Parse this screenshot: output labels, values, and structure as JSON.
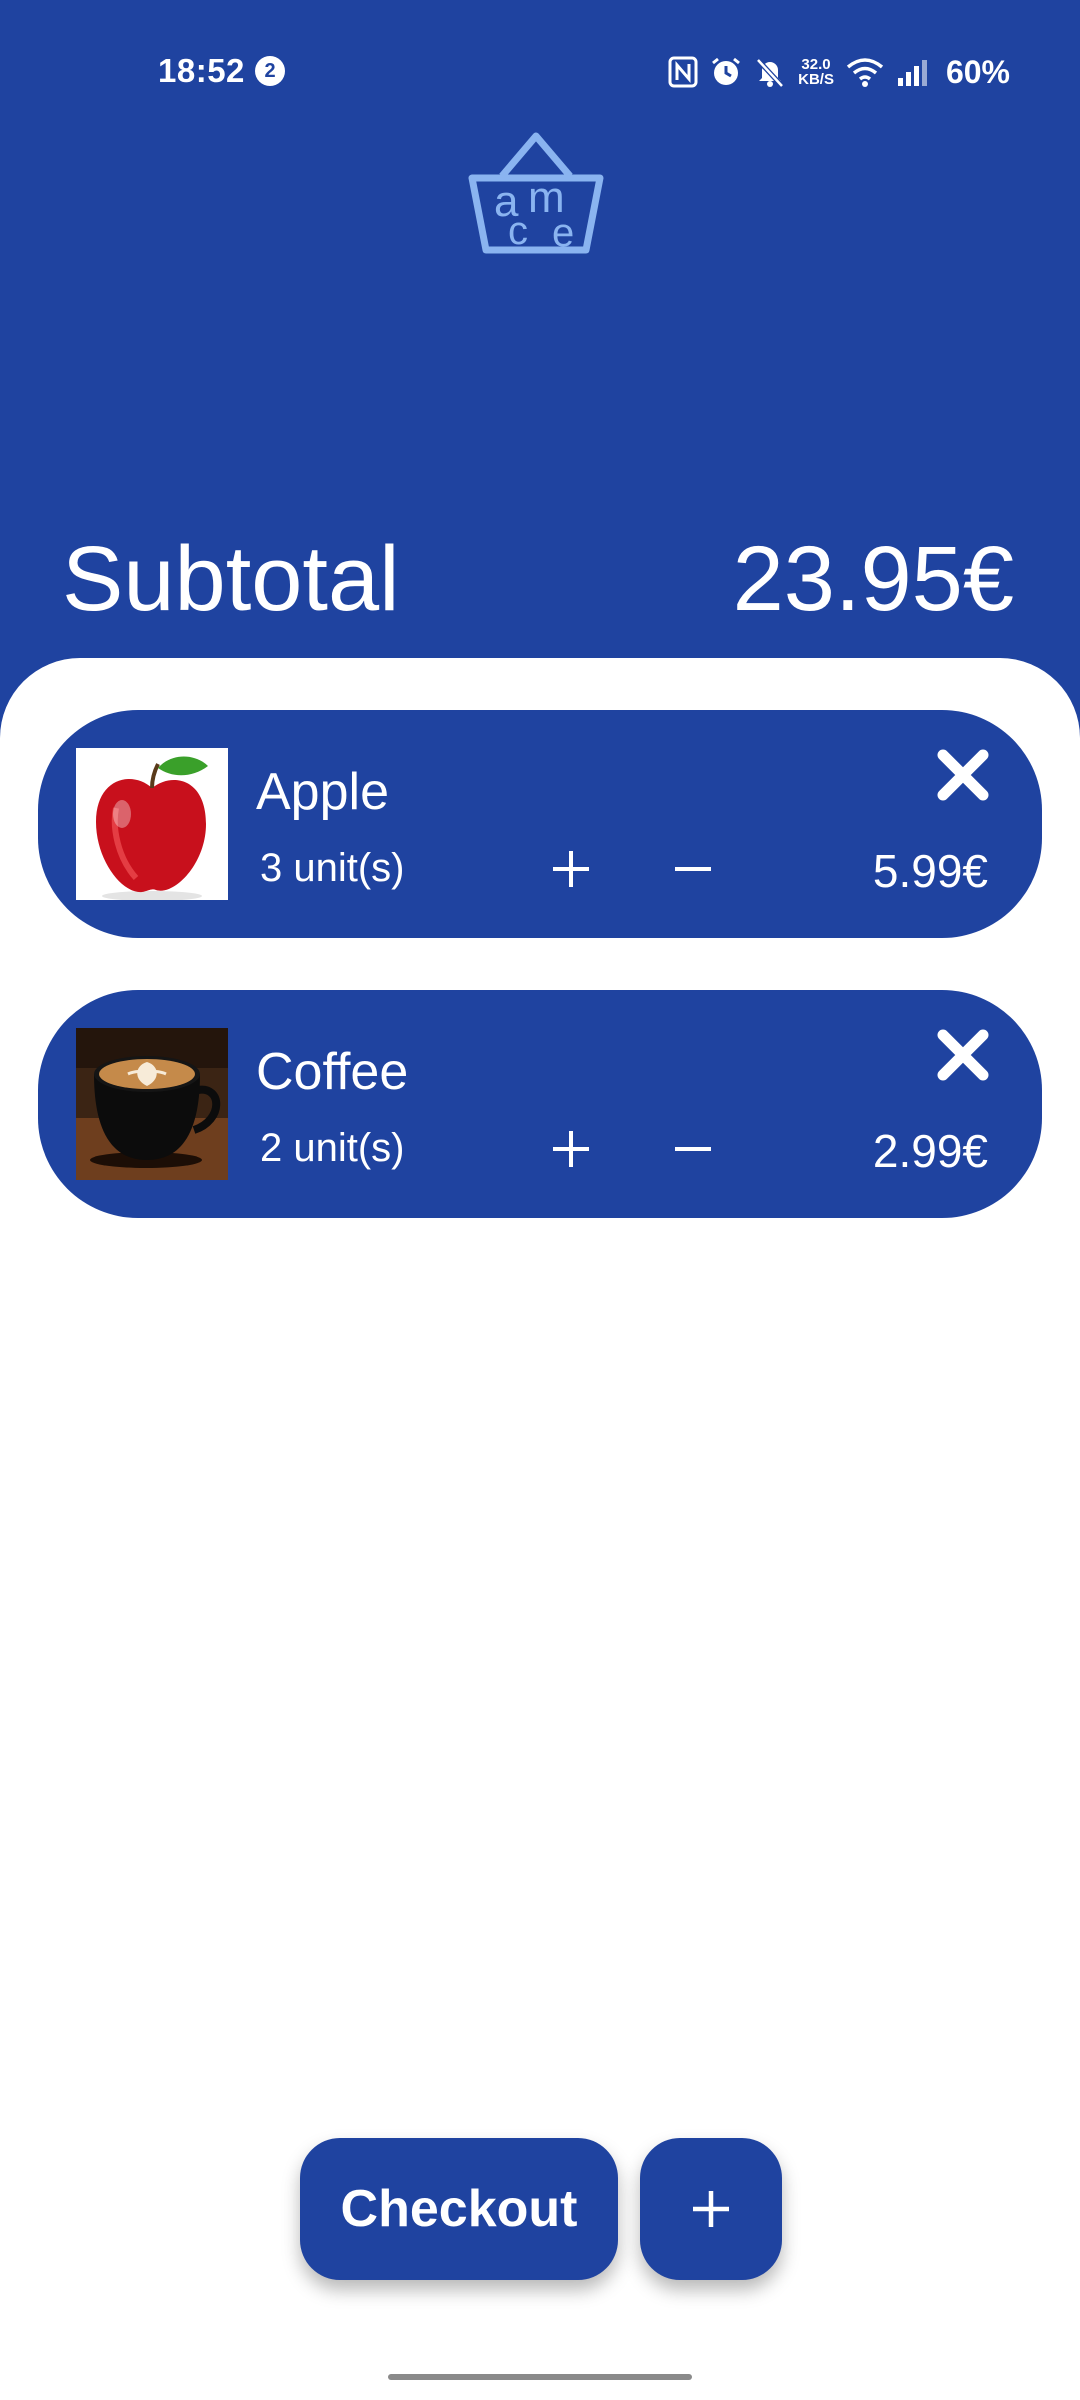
{
  "status_bar": {
    "time": "18:52",
    "notification_count": "2",
    "net_speed_value": "32.0",
    "net_speed_unit": "KB/S",
    "battery": "60%",
    "icons": [
      "nfc-icon",
      "alarm-icon",
      "mute-icon",
      "wifi-icon",
      "signal-icon"
    ]
  },
  "logo": {
    "letters": [
      "a",
      "m",
      "c",
      "e"
    ]
  },
  "summary": {
    "label": "Subtotal",
    "value": "23.95€"
  },
  "cart": {
    "items": [
      {
        "name": "Apple",
        "quantity": "3 unit(s)",
        "price": "5.99€",
        "image": "apple-image"
      },
      {
        "name": "Coffee",
        "quantity": "2 unit(s)",
        "price": "2.99€",
        "image": "coffee-image"
      }
    ]
  },
  "actions": {
    "checkout_label": "Checkout",
    "add_label": "+"
  },
  "colors": {
    "primary": "#1f43a0",
    "logo": "#8ab4f0",
    "background": "#ffffff"
  }
}
